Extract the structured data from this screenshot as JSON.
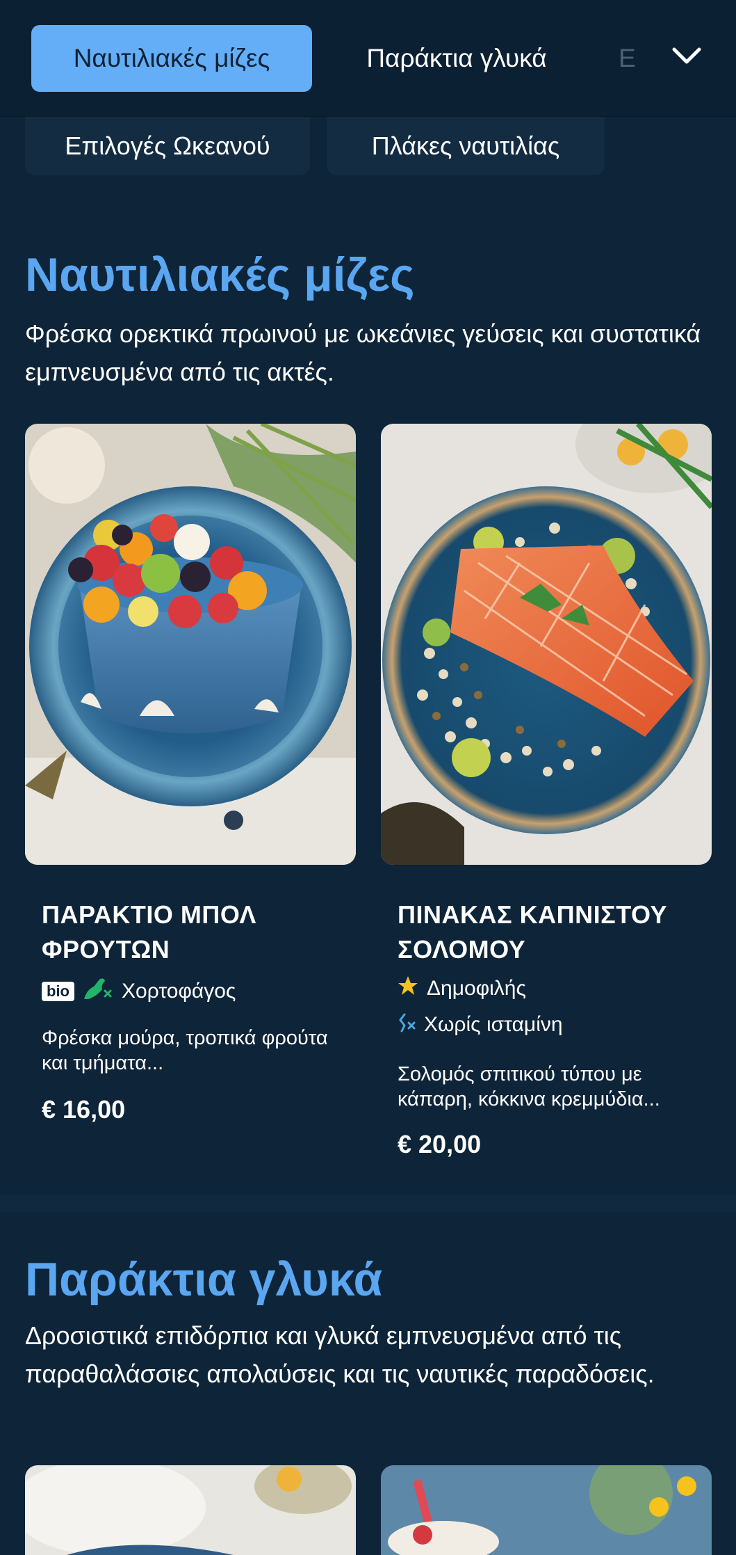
{
  "nav": {
    "tabs": [
      "Ναυτιλιακές μίζες",
      "Παράκτια γλυκά",
      "Ε"
    ],
    "chips": [
      "Επιλογές Ωκεανού",
      "Πλάκες ναυτιλίας"
    ]
  },
  "sections": [
    {
      "title": "Ναυτιλιακές μίζες",
      "description": "Φρέσκα ορεκτικά πρωινού με ωκεάνιες γεύσεις και συστατικά εμπνευσμένα από τις ακτές.",
      "items": [
        {
          "title": "ΠΑΡΑΚΤΙΟ ΜΠΟΛ ΦΡΟΥΤΩΝ",
          "badge": "bio",
          "tag": "Χορτοφάγος",
          "description": "Φρέσκα μούρα, τροπικά φρούτα και τμήματα...",
          "price": "€ 16,00"
        },
        {
          "title": "ΠΙΝΑΚΑΣ ΚΑΠΝΙΣΤΟΥ ΣΟΛΟΜΟΥ",
          "tag1": "Δημοφιλής",
          "tag2": "Χωρίς ισταμίνη",
          "description": "Σολομός σπιτικού τύπου με κάπαρη, κόκκινα κρεμμύδια...",
          "price": "€ 20,00"
        }
      ]
    },
    {
      "title": "Παράκτια γλυκά",
      "description": "Δροσιστικά επιδόρπια και γλυκά εμπνευσμένα από τις παραθαλάσσιες απολαύσεις και τις ναυτικές παραδόσεις."
    }
  ],
  "colors": {
    "background": "#0e2438",
    "accent": "#64aef7",
    "title": "#5aa6f1",
    "vegan": "#1fb56a",
    "popular": "#f6c21c",
    "histamine": "#4aa6e0"
  },
  "icons": [
    "chevron-down-icon",
    "vegan-icon",
    "star-icon",
    "histamine-free-icon"
  ]
}
